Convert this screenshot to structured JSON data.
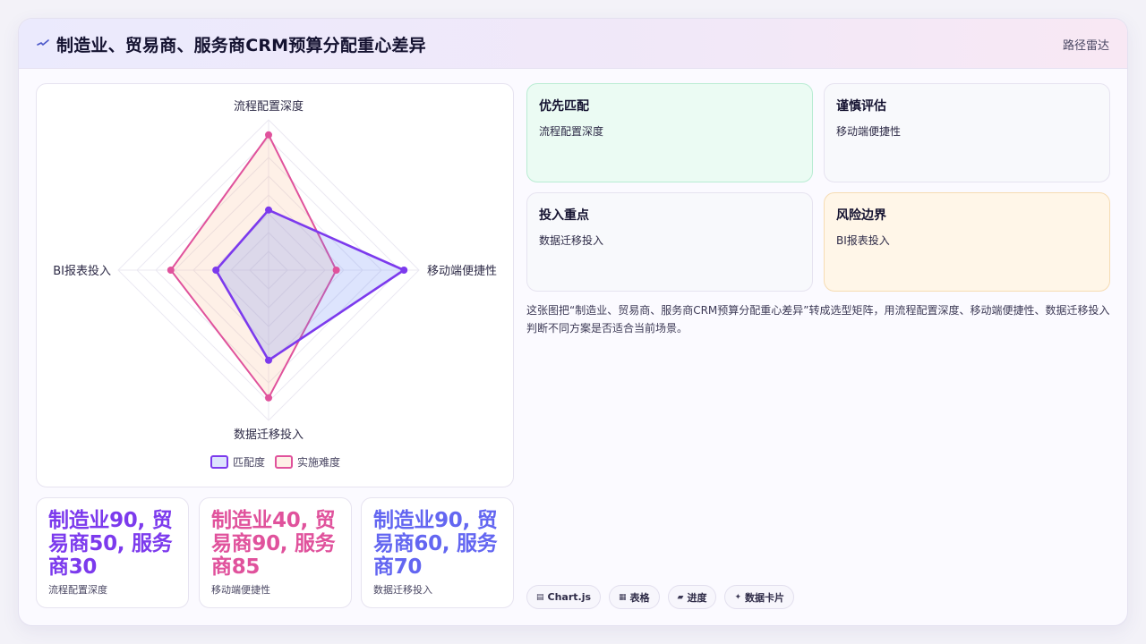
{
  "header": {
    "title": "制造业、贸易商、服务商CRM预算分配重心差异",
    "right_link": "路径雷达"
  },
  "chart_data": {
    "type": "radar",
    "axes": [
      "流程配置深度",
      "移动端便捷性",
      "数据迁移投入",
      "BI报表投入"
    ],
    "range": [
      0,
      100
    ],
    "series": [
      {
        "name": "匹配度",
        "values": [
          40,
          90,
          60,
          35
        ],
        "color": "#7c3aed"
      },
      {
        "name": "实施难度",
        "values": [
          90,
          45,
          85,
          65
        ],
        "color": "#e0529c"
      }
    ],
    "legend_position": "bottom"
  },
  "stats": [
    {
      "value": "制造业90, 贸易商50, 服务商30",
      "label": "流程配置深度",
      "color": "#7c3aed"
    },
    {
      "value": "制造业40, 贸易商90, 服务商85",
      "label": "移动端便捷性",
      "color": "#e0529c"
    },
    {
      "value": "制造业90, 贸易商60, 服务商70",
      "label": "数据迁移投入",
      "color": "#6366f1"
    }
  ],
  "info_cards": [
    {
      "title": "优先匹配",
      "sub": "流程配置深度",
      "bg": "#ebfbf3",
      "border": "#b9ecd3"
    },
    {
      "title": "谨慎评估",
      "sub": "移动端便捷性",
      "bg": "#f8f9fc",
      "border": "#e6e3f0"
    },
    {
      "title": "投入重点",
      "sub": "数据迁移投入",
      "bg": "#f8f9fc",
      "border": "#e6e3f0"
    },
    {
      "title": "风险边界",
      "sub": "BI报表投入",
      "bg": "#fff6e8",
      "border": "#f6dcb3"
    }
  ],
  "description": "这张图把“制造业、贸易商、服务商CRM预算分配重心差异”转成选型矩阵，用流程配置深度、移动端便捷性、数据迁移投入判断不同方案是否适合当前场景。",
  "tags": [
    {
      "icon": "chart-icon",
      "glyph": "▤",
      "label": "Chart.js"
    },
    {
      "icon": "table-icon",
      "glyph": "▦",
      "label": "表格"
    },
    {
      "icon": "progress-icon",
      "glyph": "▰",
      "label": "进度"
    },
    {
      "icon": "data-card-icon",
      "glyph": "✦",
      "label": "数据卡片"
    }
  ]
}
